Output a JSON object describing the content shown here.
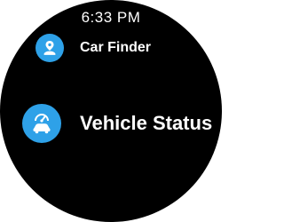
{
  "status": {
    "time": "6:33 PM"
  },
  "menu": {
    "items": [
      {
        "label": "Car Finder",
        "icon": "car-location-icon"
      },
      {
        "label": "Vehicle Status",
        "icon": "car-gauge-icon"
      }
    ]
  },
  "colors": {
    "accent": "#2ea1e8",
    "background": "#000000",
    "text": "#ffffff"
  }
}
